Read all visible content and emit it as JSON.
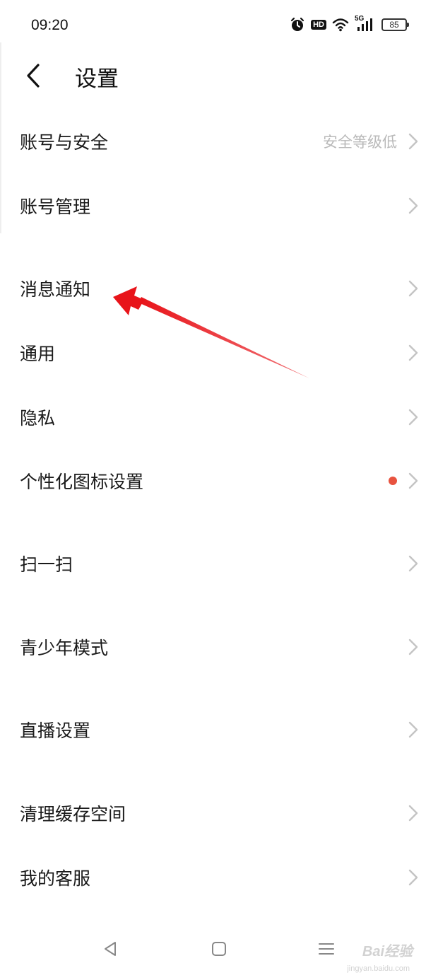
{
  "status_bar": {
    "time": "09:20",
    "battery": "85",
    "icons": [
      "alarm-icon",
      "hd-icon",
      "wifi-icon",
      "5g-signal-icon",
      "battery-icon"
    ],
    "hd_label": "HD",
    "network_label": "5G"
  },
  "header": {
    "title": "设置",
    "back_icon": "chevron-left-icon"
  },
  "menu": {
    "items": [
      {
        "label": "账号与安全",
        "sub": "安全等级低"
      },
      {
        "label": "账号管理"
      },
      {
        "label": "消息通知"
      },
      {
        "label": "通用"
      },
      {
        "label": "隐私"
      },
      {
        "label": "个性化图标设置",
        "badge": "red-dot"
      },
      {
        "label": "扫一扫"
      },
      {
        "label": "青少年模式"
      },
      {
        "label": "直播设置"
      },
      {
        "label": "清理缓存空间"
      },
      {
        "label": "我的客服"
      }
    ]
  },
  "nav_bar": {
    "icons": [
      "back-triangle-icon",
      "home-square-icon",
      "menu-lines-icon"
    ]
  },
  "watermark": {
    "text": "Bai经验",
    "sub": "jingyan.baidu.com"
  },
  "colors": {
    "background": "#ffffff",
    "text": "#1a1a1a",
    "secondary": "#b9b9b9",
    "chevron": "#c4c4c4",
    "badge": "#e8533f",
    "arrow": "#e8141a"
  }
}
